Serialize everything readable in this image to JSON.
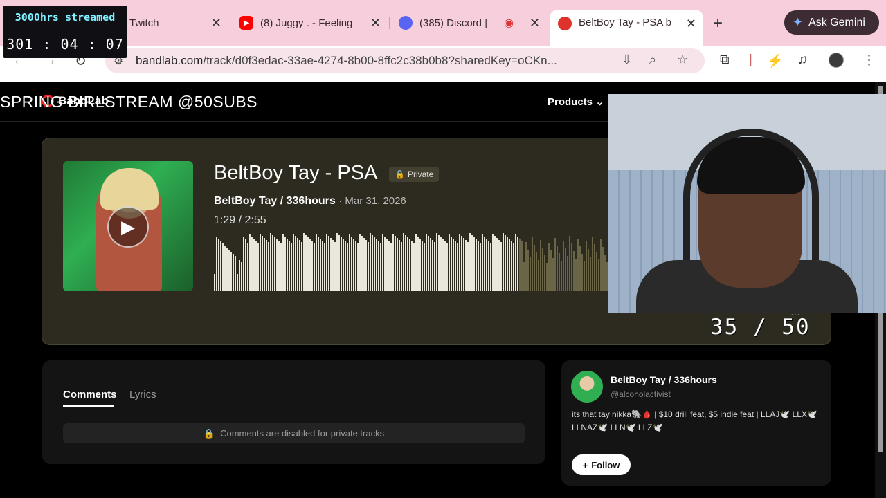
{
  "overlay": {
    "streamed_label": "3000hrs streamed",
    "timer": "301 : 04 : 07",
    "stream_title": "SPRING BIRLSTREAM @50SUBS",
    "sub_count": "35 / 50"
  },
  "browser": {
    "tabs": [
      {
        "title": "Twitch",
        "favicon": "twitch-icon"
      },
      {
        "title": "(8) Juggy . - Feeling",
        "favicon": "youtube-icon"
      },
      {
        "title": "(385) Discord |",
        "favicon": "discord-icon",
        "badge": "385"
      },
      {
        "title": "BeltBoy Tay - PSA b",
        "favicon": "bandlab-icon",
        "active": true
      }
    ],
    "new_tab": "+",
    "gemini_label": "Ask Gemini",
    "url_domain": "bandlab.com",
    "url_path": "/track/d0f3edac-33ae-4274-8b00-8ffc2c38b0b8?sharedKey=oCKn..."
  },
  "site": {
    "logo": "BandLab",
    "nav_products": "Products"
  },
  "track": {
    "title": "BeltBoy Tay - PSA",
    "privacy": "Private",
    "artist": "BeltBoy Tay / 336hours",
    "date": "· Mar 31, 2026",
    "time_current": "1:29 /",
    "time_total": "2:55",
    "progress": 0.508
  },
  "comments": {
    "tab_comments": "Comments",
    "tab_lyrics": "Lyrics",
    "disabled_text": "Comments are disabled for private tracks"
  },
  "artist_card": {
    "name": "BeltBoy Tay / 336hours",
    "handle": "@alcoholactivist",
    "bio": "its that tay nikka🐘🩸 | $10 drill feat, $5 indie feat | LLAJ🕊️ LLX🕊️ LLNAZ🕊️ LLN🕊️ LLZ🕊️",
    "follow_label": "Follow"
  },
  "colors": {
    "tabbar": "#f7cfdc",
    "player_bg": "#2d2a1f",
    "wave_played": "#e9e6dc",
    "wave_unplayed": "#6b6548"
  }
}
